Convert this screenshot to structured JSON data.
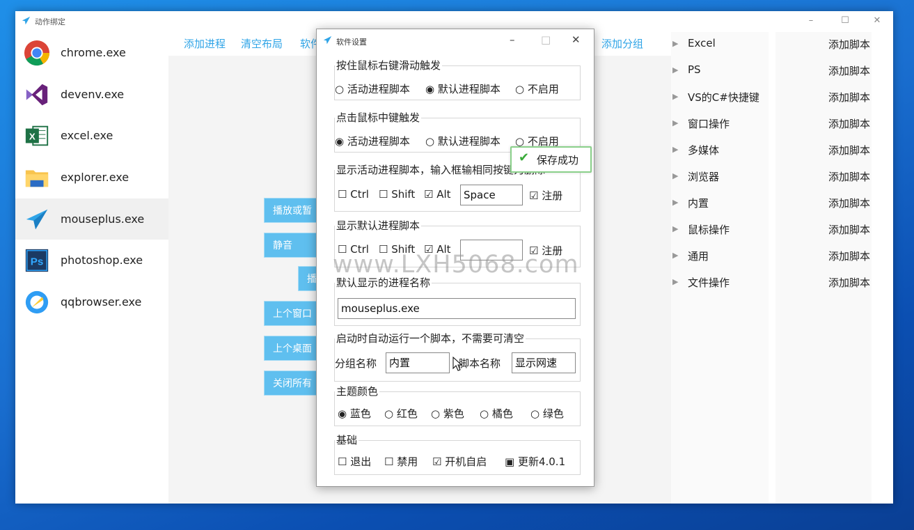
{
  "main": {
    "title": "动作绑定",
    "controls": {
      "min": "–",
      "max": "☐",
      "close": "✕"
    }
  },
  "processes": [
    {
      "name": "chrome.exe",
      "icon": "chrome-icon"
    },
    {
      "name": "devenv.exe",
      "icon": "visual-studio-icon"
    },
    {
      "name": "excel.exe",
      "icon": "excel-icon"
    },
    {
      "name": "explorer.exe",
      "icon": "folder-icon"
    },
    {
      "name": "mouseplus.exe",
      "icon": "paper-plane-icon"
    },
    {
      "name": "photoshop.exe",
      "icon": "photoshop-icon"
    },
    {
      "name": "qqbrowser.exe",
      "icon": "qqbrowser-icon"
    }
  ],
  "toolbar": {
    "add_process": "添加进程",
    "clear_layout": "清空布局",
    "software": "软件",
    "add_group": "添加分组"
  },
  "canvas_buttons": [
    "播放或暂",
    "静音",
    "播",
    "上个窗口",
    "上个桌面",
    "关闭所有"
  ],
  "groups": [
    "Excel",
    "PS",
    "VS的C#快捷键",
    "窗口操作",
    "多媒体",
    "浏览器",
    "内置",
    "鼠标操作",
    "通用",
    "文件操作"
  ],
  "add_script_label": "添加脚本",
  "dialog": {
    "title": "软件设置",
    "controls": {
      "min": "–",
      "max": "□",
      "close": "✕"
    },
    "right_drag": {
      "legend": "按住鼠标右键滑动触发",
      "options": [
        "○ 活动进程脚本",
        "◉ 默认进程脚本",
        "○ 不启用"
      ]
    },
    "middle_click": {
      "legend": "点击鼠标中键触发",
      "options": [
        "◉ 活动进程脚本",
        "○ 默认进程脚本",
        "○ 不启用"
      ]
    },
    "show_active": {
      "legend": "显示活动进程脚本，输入框输相同按键为删除",
      "ctrl": "☐ Ctrl",
      "shift": "☐ Shift",
      "alt": "☑ Alt",
      "key": "Space",
      "register": "☑ 注册"
    },
    "show_default": {
      "legend": "显示默认进程脚本",
      "ctrl": "☐ Ctrl",
      "shift": "☐ Shift",
      "alt": "☑ Alt",
      "key": "",
      "register": "☑ 注册"
    },
    "default_name": {
      "legend": "默认显示的进程名称",
      "value": "mouseplus.exe"
    },
    "autorun": {
      "legend": "启动时自动运行一个脚本，不需要可清空",
      "group_label": "分组名称",
      "group_value": "内置",
      "script_label": "脚本名称",
      "script_value": "显示网速"
    },
    "theme": {
      "legend": "主题颜色",
      "options": [
        "◉ 蓝色",
        "○ 红色",
        "○ 紫色",
        "○ 橘色",
        "○ 绿色"
      ]
    },
    "basic": {
      "legend": "基础",
      "options": [
        "☐ 退出",
        "☐ 禁用",
        "☑ 开机自启",
        "▣ 更新4.0.1"
      ]
    }
  },
  "toast": {
    "text": "保存成功"
  },
  "watermark": "www.LXH5068.com",
  "colors": {
    "accent": "#2fa4e7",
    "button_blue": "#5fbfef",
    "success": "#3aab3a"
  }
}
